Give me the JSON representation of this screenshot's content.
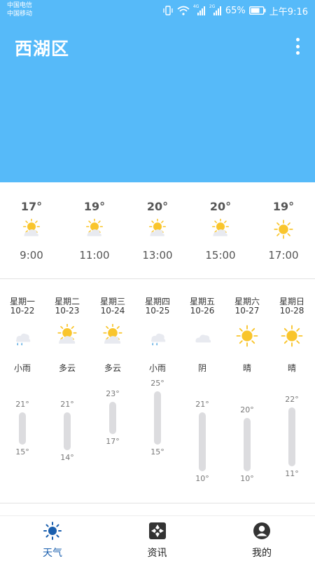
{
  "status_bar": {
    "carrier_1": "中国电信",
    "carrier_2": "中国移动",
    "signal_1_label": "4G",
    "signal_2_label": "2G",
    "battery": "65%",
    "time": "上午9:16"
  },
  "header": {
    "city": "西湖区",
    "menu_icon": "more-vertical-icon",
    "background_color": "#56baf9"
  },
  "hourly": [
    {
      "temp": "17°",
      "icon": "partly-cloudy-icon",
      "time": "9:00"
    },
    {
      "temp": "19°",
      "icon": "partly-cloudy-icon",
      "time": "11:00"
    },
    {
      "temp": "20°",
      "icon": "partly-cloudy-icon",
      "time": "13:00"
    },
    {
      "temp": "20°",
      "icon": "partly-cloudy-icon",
      "time": "15:00"
    },
    {
      "temp": "19°",
      "icon": "sun-icon",
      "time": "17:00"
    }
  ],
  "daily": [
    {
      "weekday": "星期一",
      "date": "10-22",
      "icon": "light-rain-icon",
      "condition": "小雨",
      "high": "21°",
      "low": "15°",
      "high_value": 21,
      "low_value": 15
    },
    {
      "weekday": "星期二",
      "date": "10-23",
      "icon": "partly-cloudy-icon",
      "condition": "多云",
      "high": "21°",
      "low": "14°",
      "high_value": 21,
      "low_value": 14
    },
    {
      "weekday": "星期三",
      "date": "10-24",
      "icon": "partly-cloudy-icon",
      "condition": "多云",
      "high": "23°",
      "low": "17°",
      "high_value": 23,
      "low_value": 17
    },
    {
      "weekday": "星期四",
      "date": "10-25",
      "icon": "light-rain-icon",
      "condition": "小雨",
      "high": "25°",
      "low": "15°",
      "high_value": 25,
      "low_value": 15
    },
    {
      "weekday": "星期五",
      "date": "10-26",
      "icon": "overcast-icon",
      "condition": "阴",
      "high": "21°",
      "low": "10°",
      "high_value": 21,
      "low_value": 10
    },
    {
      "weekday": "星期六",
      "date": "10-27",
      "icon": "sun-icon",
      "condition": "晴",
      "high": "20°",
      "low": "10°",
      "high_value": 20,
      "low_value": 10
    },
    {
      "weekday": "星期日",
      "date": "10-28",
      "icon": "sun-icon",
      "condition": "晴",
      "high": "22°",
      "low": "11°",
      "high_value": 22,
      "low_value": 11
    }
  ],
  "bottom_nav": [
    {
      "label": "天气",
      "icon": "weather-sun-icon",
      "active": true
    },
    {
      "label": "资讯",
      "icon": "news-icon",
      "active": false
    },
    {
      "label": "我的",
      "icon": "profile-icon",
      "active": false
    }
  ],
  "colors": {
    "sun": "#f9c52c",
    "rain": "#4da3e0",
    "cloud": "#e8eaf0",
    "active_nav": "#1a5fae",
    "bar": "#dcdcdf"
  }
}
